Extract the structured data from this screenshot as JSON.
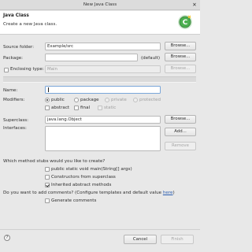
{
  "window": {
    "title": "New Java Class"
  },
  "header": {
    "title": "Java Class",
    "description": "Create a new Java class."
  },
  "source_folder": {
    "label": "Source folder:",
    "value": "Example/src",
    "button": "Browse..."
  },
  "package": {
    "label": "Package:",
    "value": "",
    "suffix": "(default)",
    "button": "Browse..."
  },
  "enclosing_type": {
    "label": "Enclosing type:",
    "value": "Main",
    "button": "Browse...",
    "checked": false
  },
  "name": {
    "label": "Name:",
    "value": ""
  },
  "modifiers": {
    "label": "Modifiers:",
    "public": "public",
    "package": "package",
    "private": "private",
    "protected": "protected",
    "abstract": "abstract",
    "final": "final",
    "static": "static",
    "selected": "public"
  },
  "superclass": {
    "label": "Superclass:",
    "value": "java.lang.Object",
    "button": "Browse..."
  },
  "interfaces": {
    "label": "Interfaces:",
    "add_button": "Add...",
    "remove_button": "Remove",
    "items": []
  },
  "stubs": {
    "question": "Which method stubs would you like to create?",
    "main": "public static void main(String[] args)",
    "constructors": "Constructors from superclass",
    "inherited": "Inherited abstract methods",
    "main_checked": false,
    "constructors_checked": false,
    "inherited_checked": true
  },
  "comments": {
    "question": "Do you want to add comments? (Configure templates and default value ",
    "link": "here",
    "question_end": ")",
    "generate": "Generate comments",
    "generate_checked": false
  },
  "footer": {
    "help": "?",
    "cancel": "Cancel",
    "finish": "Finish"
  },
  "colors": {
    "banner_green": "#4caf50",
    "link": "#2a5db0"
  },
  "icons": {
    "banner": "new-class-wizard-icon",
    "help": "help-icon",
    "close": "close-icon"
  }
}
